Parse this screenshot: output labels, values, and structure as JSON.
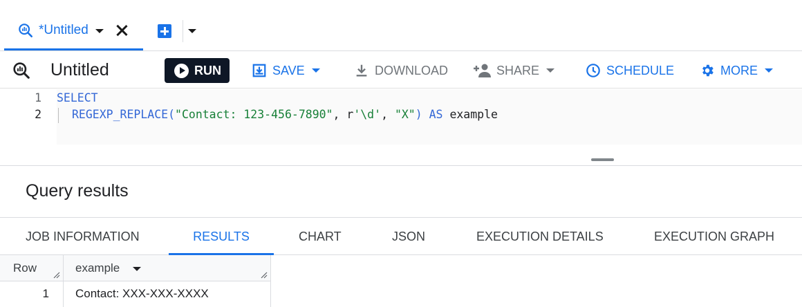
{
  "tabbar": {
    "active_tab_label": "*Untitled"
  },
  "toolbar": {
    "query_title": "Untitled",
    "run_label": "RUN",
    "save_label": "SAVE",
    "download_label": "DOWNLOAD",
    "share_label": "SHARE",
    "schedule_label": "SCHEDULE",
    "more_label": "MORE"
  },
  "editor": {
    "line_numbers": [
      "1",
      "2"
    ],
    "line1": {
      "keyword": "SELECT"
    },
    "line2": {
      "func": "REGEXP_REPLACE(",
      "arg1": "\"Contact: 123-456-7890\"",
      "sep1": ", r",
      "arg2": "'\\d'",
      "sep2": ", ",
      "arg3": "\"X\"",
      "close": ")",
      "as_kw": "AS",
      "alias": "example"
    }
  },
  "results": {
    "title": "Query results",
    "tabs": [
      "JOB INFORMATION",
      "RESULTS",
      "CHART",
      "JSON",
      "EXECUTION DETAILS",
      "EXECUTION GRAPH"
    ],
    "active_tab": "RESULTS",
    "columns": [
      "Row",
      "example"
    ],
    "rows": [
      {
        "row": "1",
        "example": "Contact: XXX-XXX-XXXX"
      }
    ]
  },
  "colors": {
    "accent": "#1a73e8",
    "run_button": "#0e1726",
    "keyword": "#3367d6",
    "string": "#188038"
  },
  "icons": {
    "query": "query-magnifier-icon",
    "new_tab": "plus-box-icon",
    "save": "save-icon",
    "download": "download-icon",
    "share": "person-add-icon",
    "schedule": "clock-icon",
    "more": "gear-icon"
  }
}
